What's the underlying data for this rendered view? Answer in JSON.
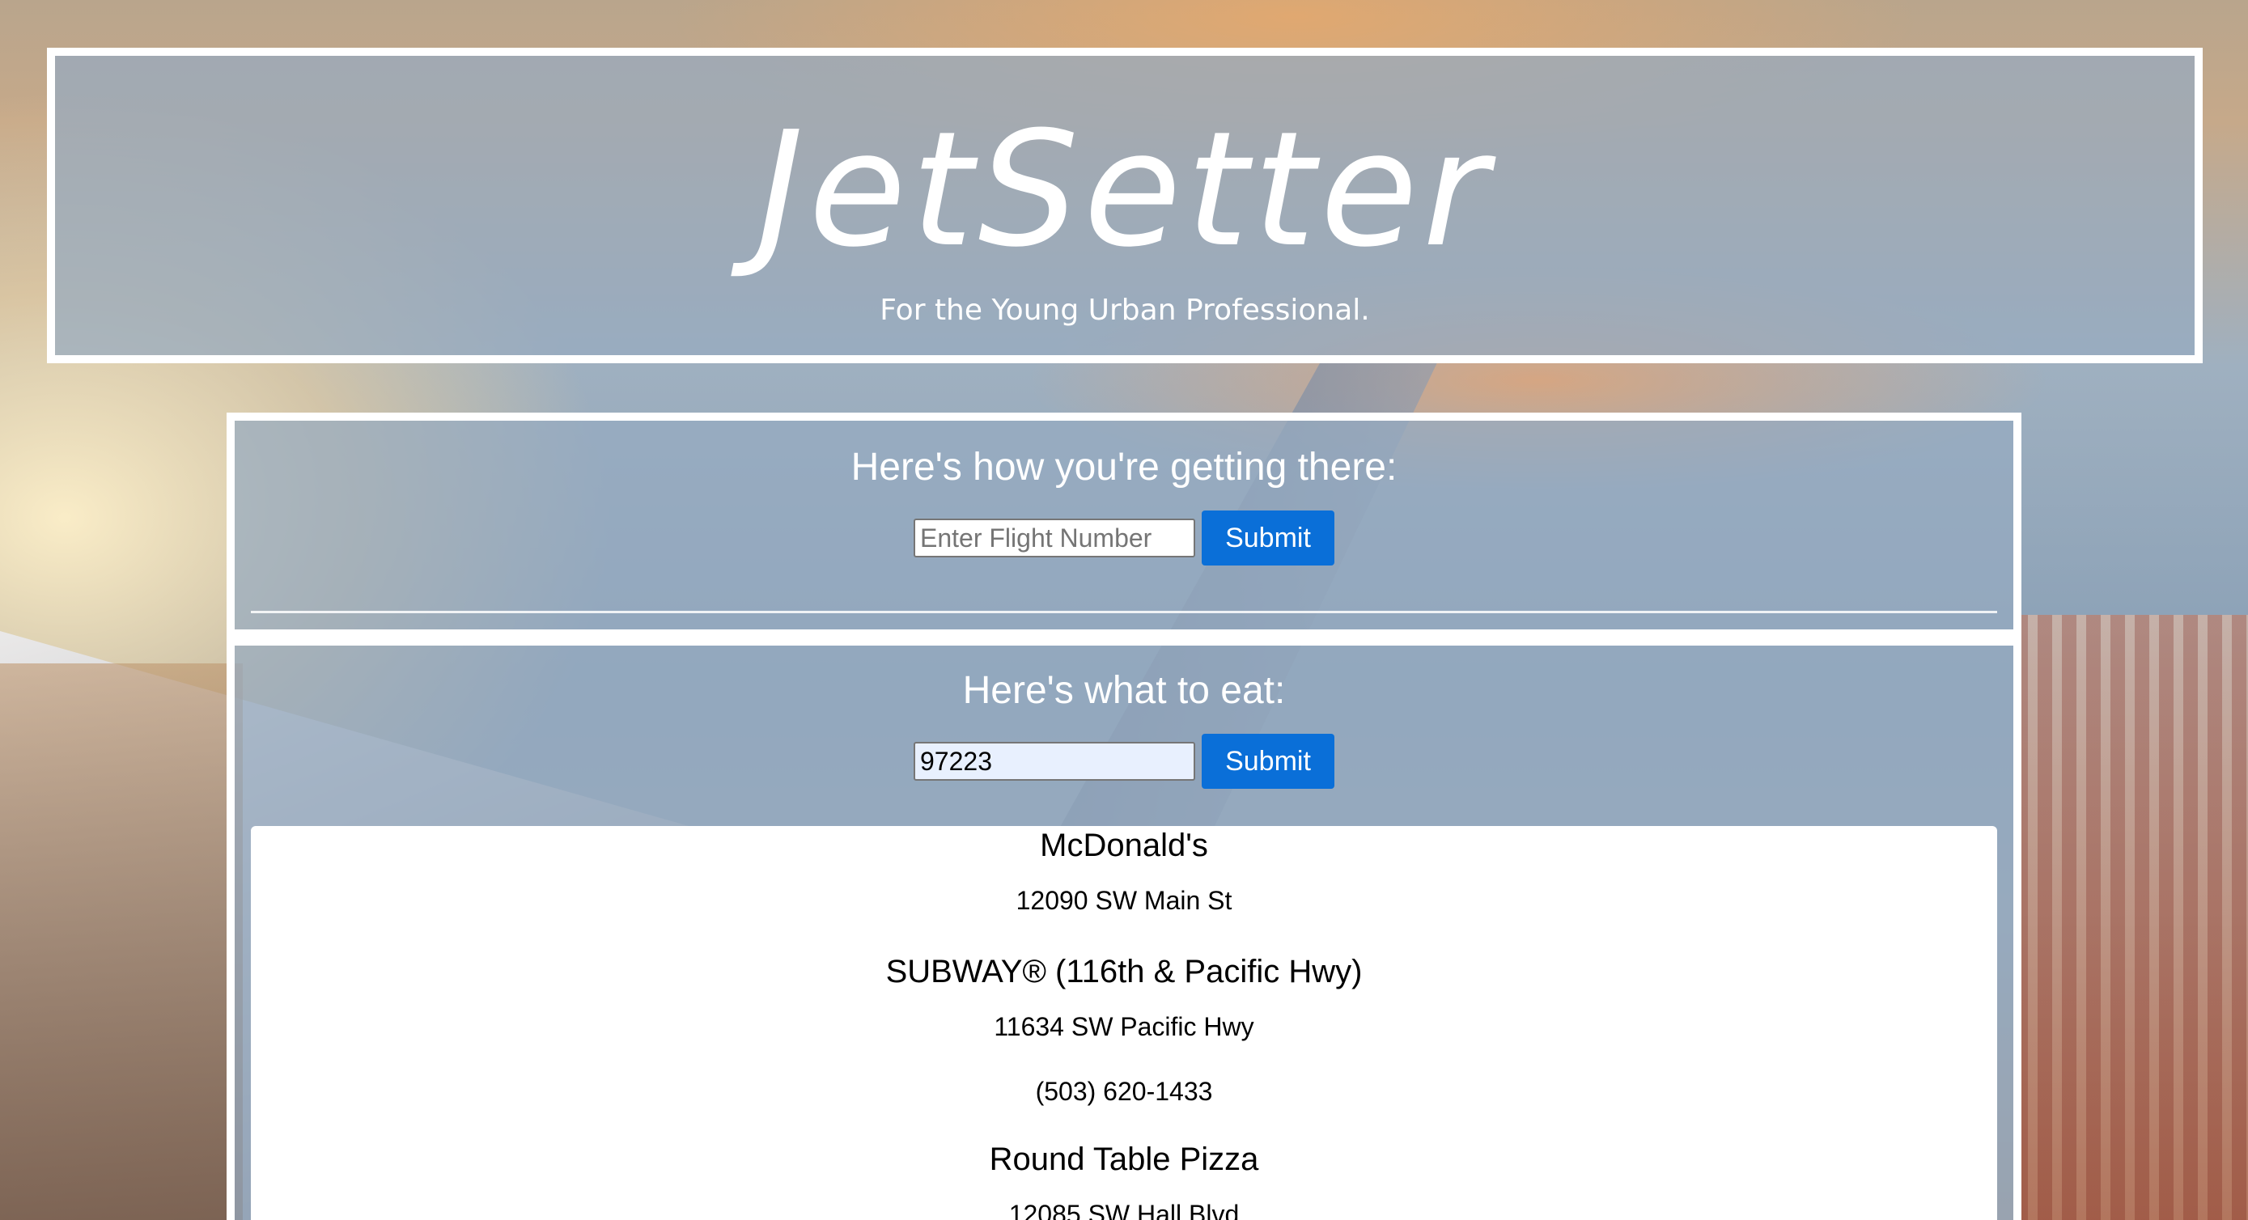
{
  "header": {
    "logo": "JetSetter",
    "tagline": "For the Young Urban Professional."
  },
  "flight": {
    "title": "Here's how you're getting there:",
    "placeholder": "Enter Flight Number",
    "value": "",
    "submit_label": "Submit"
  },
  "food": {
    "title": "Here's what to eat:",
    "placeholder": "",
    "value": "97223",
    "submit_label": "Submit",
    "results": [
      {
        "name": "McDonald's",
        "address": "12090 SW Main St"
      },
      {
        "name": "SUBWAY® (116th & Pacific Hwy)",
        "address": "11634 SW Pacific Hwy",
        "phone": "(503) 620-1433"
      },
      {
        "name": "Round Table Pizza",
        "address": "12085 SW Hall Blvd"
      }
    ]
  },
  "colors": {
    "button": "#0a6fd8",
    "panel": "#96aac0",
    "border": "#ffffff"
  }
}
